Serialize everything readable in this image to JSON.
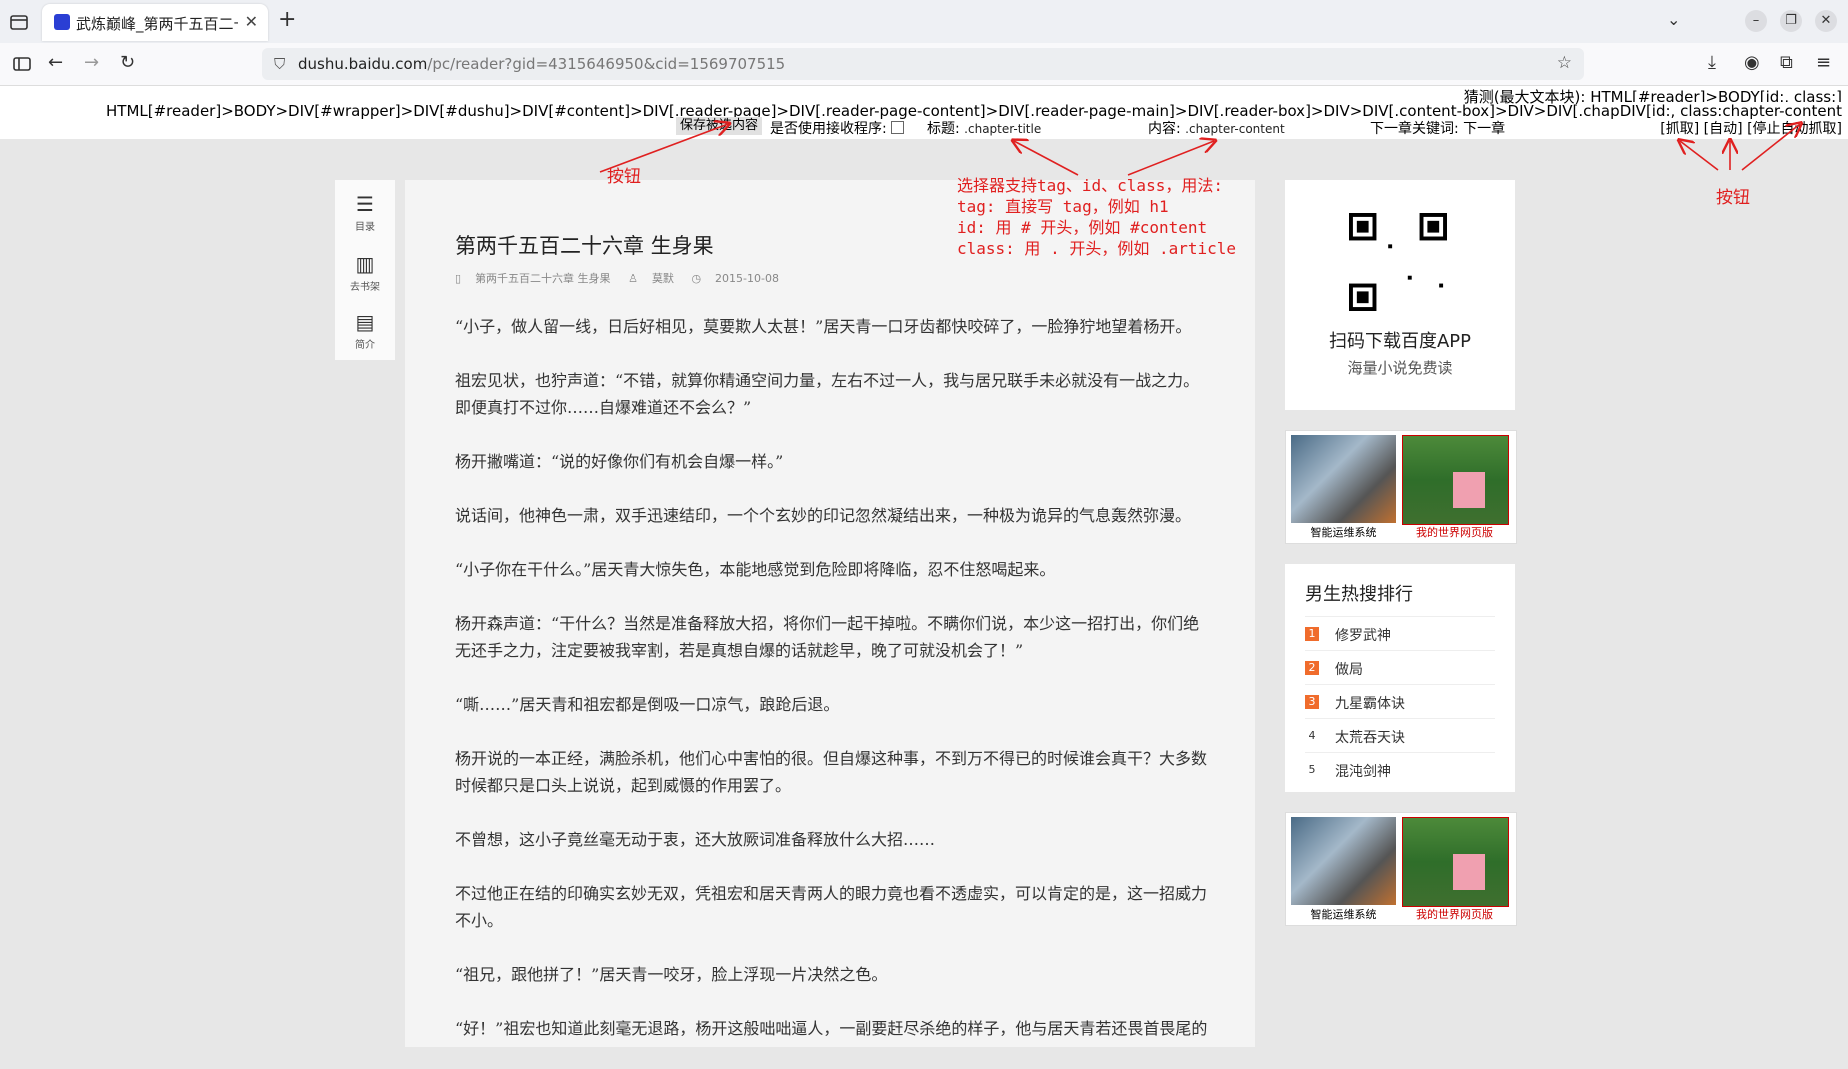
{
  "browser": {
    "tab_title": "武炼巅峰_第两千五百二十六章 生身果",
    "url_host": "dushu.baidu.com",
    "url_path": "/pc/reader?gid=4315646950&cid=1569707515"
  },
  "toolbar": {
    "guess": "猜测(最大文本块): HTML[#reader]>BODY[id:, class:]",
    "guess2": "DIV[id:, class:chapter-content",
    "path": "HTML[#reader]>BODY>DIV[#wrapper]>DIV[#dushu]>DIV[#content]>DIV[.reader-page]>DIV[.reader-page-content]>DIV[.reader-page-main]>DIV[.reader-box]>DIV>DIV[.content-box]>DIV>DIV[.chapter-content-wrap]>DIV",
    "save_label": "保存被选内容",
    "use_receiver_label": "是否使用接收程序:",
    "title_label": "标题:",
    "title_selector": ".chapter-title",
    "content_label": "内容:",
    "content_selector": ".chapter-content",
    "next_label": "下一章关键词:",
    "next_value": "下一章",
    "grab_label": "[抓取]",
    "auto_label": "[自动]",
    "stop_label": "[停止自动抓取]"
  },
  "annotations": {
    "button_left": "按钮",
    "button_right": "按钮",
    "selector_help": [
      "选择器支持tag、id、class，用法:",
      "tag: 直接写 tag，例如 h1",
      "id: 用 # 开头，例如 #content",
      "class: 用 . 开头，例如 .article"
    ]
  },
  "sidenav": [
    {
      "label": "目录",
      "icon": "menu-icon"
    },
    {
      "label": "去书架",
      "icon": "bookshelf-icon"
    },
    {
      "label": "简介",
      "icon": "intro-icon"
    }
  ],
  "chapter": {
    "title": "第两千五百二十六章 生身果",
    "meta_chapter": "第两千五百二十六章 生身果",
    "meta_author": "莫默",
    "meta_date": "2015-10-08",
    "paragraphs": [
      "“小子，做人留一线，日后好相见，莫要欺人太甚！”居天青一口牙齿都快咬碎了，一脸狰狞地望着杨开。",
      "祖宏见状，也狞声道：“不错，就算你精通空间力量，左右不过一人，我与居兄联手未必就没有一战之力。即便真打不过你……自爆难道还不会么？”",
      "杨开撇嘴道：“说的好像你们有机会自爆一样。”",
      "说话间，他神色一肃，双手迅速结印，一个个玄妙的印记忽然凝结出来，一种极为诡异的气息轰然弥漫。",
      "“小子你在干什么。”居天青大惊失色，本能地感觉到危险即将降临，忍不住怒喝起来。",
      "杨开森声道：“干什么？当然是准备释放大招，将你们一起干掉啦。不瞒你们说，本少这一招打出，你们绝无还手之力，注定要被我宰割，若是真想自爆的话就趁早，晚了可就没机会了！”",
      "“嘶……”居天青和祖宏都是倒吸一口凉气，踉跄后退。",
      "杨开说的一本正经，满脸杀机，他们心中害怕的很。但自爆这种事，不到万不得已的时候谁会真干？大多数时候都只是口头上说说，起到威慑的作用罢了。",
      "不曾想，这小子竟丝毫无动于衷，还大放厥词准备释放什么大招……",
      "不过他正在结的印确实玄妙无双，凭祖宏和居天青两人的眼力竟也看不透虚实，可以肯定的是，这一招威力不小。",
      "“祖兄，跟他拼了！”居天青一咬牙，脸上浮现一片决然之色。",
      "“好！”祖宏也知道此刻毫无退路，杨开这般咄咄逼人，一副要赶尽杀绝的样子，他与居天青若还畏首畏尾的"
    ]
  },
  "app_card": {
    "title": "扫码下载百度APP",
    "subtitle": "海量小说免费读"
  },
  "ads": [
    {
      "caption1": "智能运维系统",
      "caption2": "我的世界网页版"
    },
    {
      "caption1": "智能运维系统",
      "caption2": "我的世界网页版"
    }
  ],
  "ranking": {
    "title": "男生热搜排行",
    "items": [
      {
        "no": "1",
        "name": "修罗武神"
      },
      {
        "no": "2",
        "name": "做局"
      },
      {
        "no": "3",
        "name": "九星霸体诀"
      },
      {
        "no": "4",
        "name": "太荒吞天诀"
      },
      {
        "no": "5",
        "name": "混沌剑神"
      }
    ]
  },
  "colors": {
    "annotation": "#e02020",
    "rank_hot": "#f06c2c"
  }
}
